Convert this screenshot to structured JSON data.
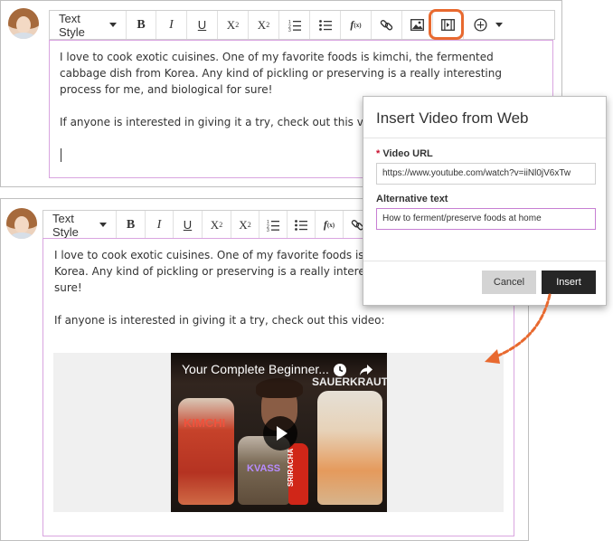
{
  "toolbar": {
    "text_style_label": "Text Style",
    "bold_label": "B",
    "italic_label": "I",
    "underline_label": "U",
    "superscript_label": "X",
    "superscript_mark": "2",
    "subscript_label": "X",
    "subscript_mark": "2",
    "math_label": "f",
    "math_mark": "(x)"
  },
  "post": {
    "paragraph_1": "I love to cook exotic cuisines. One of my favorite foods is kimchi, the fermented cabbage dish from Korea. Any kind of pickling or preserving is a really interesting process for me, and biological for sure!",
    "paragraph_2": "If anyone is interested in giving it a try, check out this video:",
    "paragraph_1_line_1": "I love to cook exotic cuisines. One of my favorite foods is kimchi, the",
    "paragraph_1_line_2": "Korea. Any kind of pickling or preserving is a really interesting proces",
    "paragraph_1_line_3": "sure!"
  },
  "dialog": {
    "title": "Insert Video from Web",
    "required_marker": "*",
    "video_url_label": "Video URL",
    "video_url_value": "https://www.youtube.com/watch?v=iiNl0jV6xTw",
    "alt_text_label": "Alternative text",
    "alt_text_value": "How to ferment/preserve foods at home",
    "cancel_label": "Cancel",
    "insert_label": "Insert"
  },
  "video": {
    "title": "Your Complete Beginner...",
    "jar_labels": {
      "kimchi": "KIMCHI",
      "kvass": "KVASS",
      "sriracha": "SRIRACHA",
      "sauerkraut": "SAUERKRAUT"
    }
  },
  "colors": {
    "highlight": "#e8692f",
    "editor_border": "#d9a5e0",
    "arrow": "#e8692f",
    "required": "#c8102e"
  },
  "icons": {
    "ordered_list": "ordered-list-icon",
    "unordered_list": "bullet-list-icon",
    "link": "link-icon",
    "image": "image-icon",
    "video": "video-icon",
    "add_content": "plus-circle-icon",
    "clock": "clock-icon",
    "share": "share-icon",
    "play": "play-icon"
  }
}
